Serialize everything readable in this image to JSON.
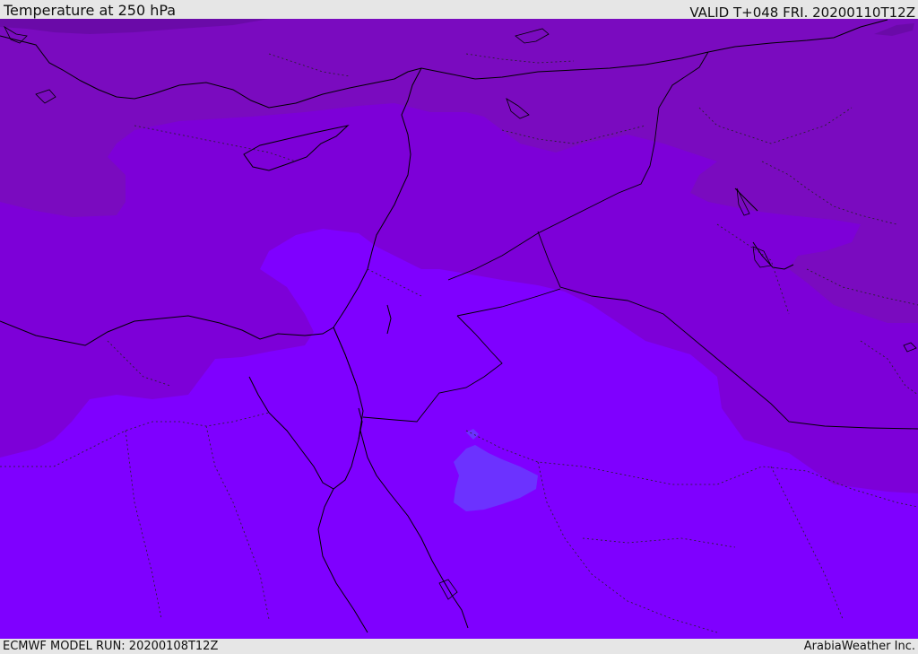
{
  "header": {
    "title": "Temperature at 250 hPa",
    "valid": "VALID T+048 FRI. 20200110T12Z"
  },
  "footer": {
    "model_run": "ECMWF MODEL RUN: 20200108T12Z",
    "credit": "ArabiaWeather Inc."
  },
  "map": {
    "field": "temperature",
    "level": "250 hPa",
    "colors": {
      "coldest_band": "#6c0aa6",
      "cold_band": "#780cba",
      "mid_band": "#7c00da",
      "warm_band": "#7f00ff",
      "warmest_patch": "#6a33ff",
      "coastline": "#000000",
      "border": "#000000"
    }
  }
}
